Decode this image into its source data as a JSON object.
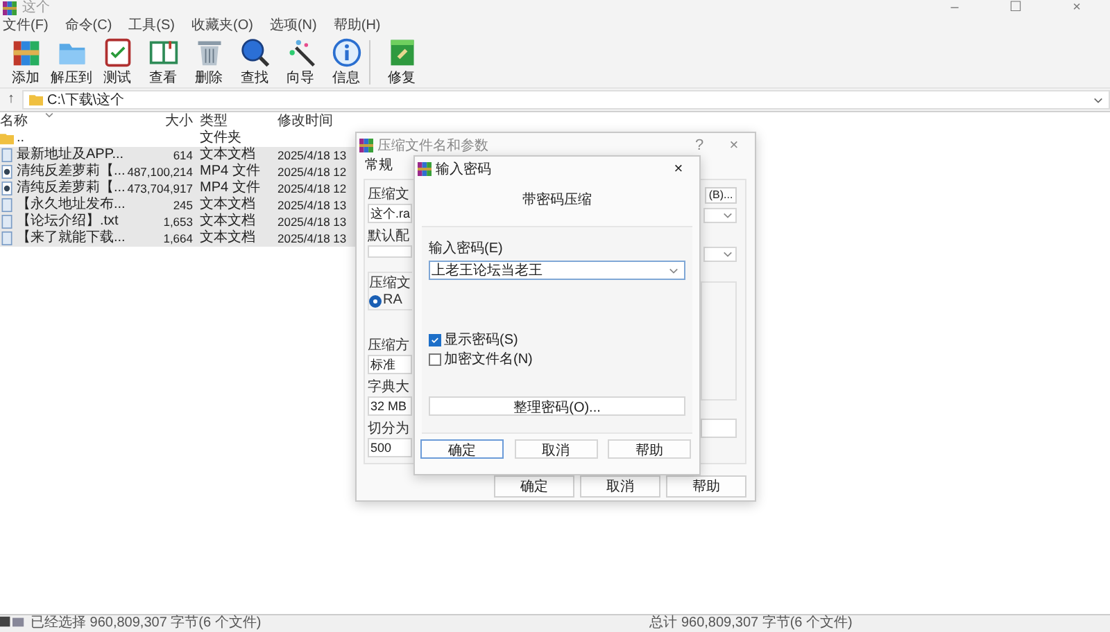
{
  "window": {
    "title": "这个",
    "controls": [
      "–",
      "☐",
      "×"
    ]
  },
  "menu": [
    "文件(F)",
    "命令(C)",
    "工具(S)",
    "收藏夹(O)",
    "选项(N)",
    "帮助(H)"
  ],
  "toolbar": {
    "groups": [
      [
        {
          "label": "添加",
          "kind": "add"
        },
        {
          "label": "解压到",
          "kind": "extract"
        },
        {
          "label": "测试",
          "kind": "test"
        },
        {
          "label": "查看",
          "kind": "view"
        },
        {
          "label": "删除",
          "kind": "delete"
        },
        {
          "label": "查找",
          "kind": "find"
        },
        {
          "label": "向导",
          "kind": "wizard"
        },
        {
          "label": "信息",
          "kind": "info"
        }
      ],
      [
        {
          "label": "修复",
          "kind": "repair"
        }
      ]
    ]
  },
  "address": {
    "up": "↑",
    "path": "C:\\下载\\这个"
  },
  "table": {
    "columns": [
      "名称",
      "大小",
      "类型",
      "修改时间"
    ],
    "rows": [
      {
        "kind": "folder",
        "name": "..",
        "size": "",
        "type": "文件夹",
        "modified": "",
        "selected": false
      },
      {
        "kind": "text",
        "name": "最新地址及APP...",
        "size": "614",
        "type": "文本文档",
        "modified": "2025/4/18 13",
        "selected": true
      },
      {
        "kind": "video",
        "name": "清纯反差萝莉【...",
        "size": "487,100,214",
        "type": "MP4 文件",
        "modified": "2025/4/18 12",
        "selected": true
      },
      {
        "kind": "video",
        "name": "清纯反差萝莉【...",
        "size": "473,704,917",
        "type": "MP4 文件",
        "modified": "2025/4/18 12",
        "selected": true
      },
      {
        "kind": "text",
        "name": "【永久地址发布...",
        "size": "245",
        "type": "文本文档",
        "modified": "2025/4/18 13",
        "selected": true
      },
      {
        "kind": "text",
        "name": "【论坛介绍】.txt",
        "size": "1,653",
        "type": "文本文档",
        "modified": "2025/4/18 13",
        "selected": true
      },
      {
        "kind": "text",
        "name": "【来了就能下载...",
        "size": "1,664",
        "type": "文本文档",
        "modified": "2025/4/18 13",
        "selected": true
      }
    ]
  },
  "status_bar": {
    "selected": "已经选择 960,809,307 字节(6 个文件)",
    "total": "总计 960,809,307 字节(6 个文件)"
  },
  "archive_dialog": {
    "title": "压缩文件名和参数",
    "help": "?",
    "close": "×",
    "tab": "常规",
    "left": [
      {
        "kind": "label",
        "text": "压缩文"
      },
      {
        "kind": "field",
        "text": "这个.ra"
      },
      {
        "kind": "label",
        "text": "默认配"
      },
      {
        "kind": "field"
      },
      {
        "kind": "group",
        "text": "压缩文",
        "option": "RA",
        "selected": true
      },
      {
        "kind": "label",
        "text": "压缩方"
      },
      {
        "kind": "field",
        "text": "标准"
      },
      {
        "kind": "label",
        "text": "字典大"
      },
      {
        "kind": "field",
        "text": "32 MB"
      },
      {
        "kind": "label",
        "text": "切分为"
      },
      {
        "kind": "field",
        "text": "500"
      }
    ],
    "browse": "(B)...",
    "buttons": [
      "确定",
      "取消",
      "帮助"
    ]
  },
  "password_dialog": {
    "title": "输入密码",
    "close": "×",
    "heading": "带密码压缩",
    "label": "输入密码(E)",
    "value": "上老王论坛当老王",
    "options": [
      {
        "label": "显示密码(S)",
        "checked": true
      },
      {
        "label": "加密文件名(N)",
        "checked": false
      }
    ],
    "organize": "整理密码(O)...",
    "buttons": [
      {
        "label": "确定",
        "default": true
      },
      {
        "label": "取消",
        "default": false
      },
      {
        "label": "帮助",
        "default": false
      }
    ]
  }
}
